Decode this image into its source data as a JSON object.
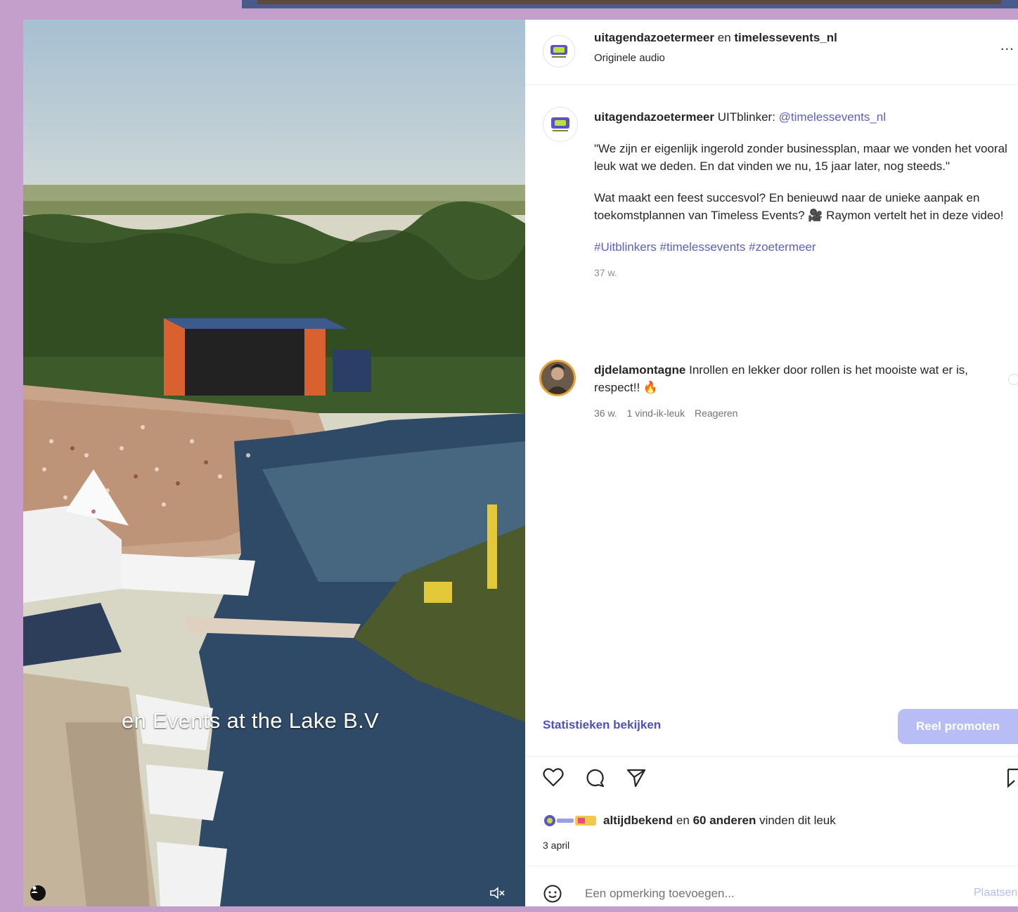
{
  "video": {
    "subtitle": "en Events at the Lake B.V",
    "user_tag_icon": "person-icon",
    "mute_icon": "speaker-muted-icon"
  },
  "header": {
    "account": "uitagendazoetermeer",
    "connector": "en",
    "collaborator": "timelessevents_nl",
    "audio": "Originele audio",
    "more": "..."
  },
  "caption": {
    "user": "uitagendazoetermeer",
    "lead": "UITblinker:",
    "mention": "@timelessevents_nl",
    "para1": "\"We zijn er eigenlijk ingerold zonder businessplan, maar we vonden het vooral leuk wat we deden. En dat vinden we nu, 15 jaar later, nog steeds.\"",
    "para2": "Wat maakt een feest succesvol? En benieuwd naar de unieke aanpak en toekomstplannen van Timeless Events? 🎥 Raymon vertelt het in deze video!",
    "hashtags": "#Uitblinkers #timelessevents #zoetermeer",
    "time": "37 w."
  },
  "comment": {
    "user": "djdelamontagne",
    "text": "Inrollen en lekker door rollen is het mooiste wat er is, respect!! 🔥",
    "time": "36 w.",
    "likes": "1 vind-ik-leuk",
    "reply": "Reageren"
  },
  "footer": {
    "stats_link": "Statistieken bekijken",
    "promote": "Reel promoten",
    "likes_user": "altijdbekend",
    "likes_connector": "en",
    "likes_others": "60 anderen",
    "likes_suffix": "vinden dit leuk",
    "date": "3 april",
    "comment_placeholder": "Een opmerking toevoegen...",
    "post": "Plaatsen"
  },
  "colors": {
    "frame": "#c59fcc",
    "link": "#4d4fc8",
    "promote_bg": "#b8bdf6"
  }
}
